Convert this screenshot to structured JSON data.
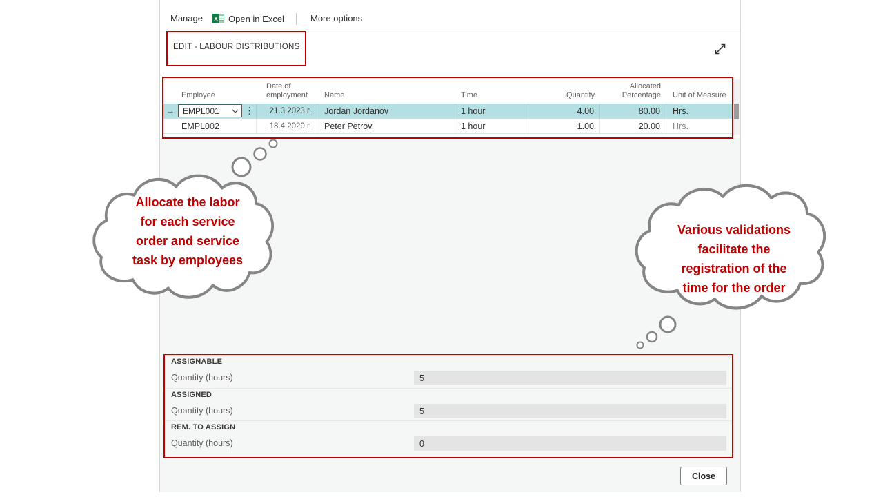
{
  "toolbar": {
    "manage": "Manage",
    "open_in_excel": "Open in Excel",
    "more_options": "More options"
  },
  "dialog": {
    "title": "EDIT - LABOUR DISTRIBUTIONS",
    "close": "Close"
  },
  "table": {
    "columns": [
      "Employee",
      "Date of\nemployment",
      "Name",
      "Time",
      "Quantity",
      "Allocated\nPercentage",
      "Unit of Measure"
    ],
    "rows": [
      {
        "employee": "EMPL001",
        "date": "21.3.2023 г.",
        "name": "Jordan Jordanov",
        "time": "1 hour",
        "quantity": "4.00",
        "allocated_percentage": "80.00",
        "unit_of_measure": "Hrs.",
        "selected": true
      },
      {
        "employee": "EMPL002",
        "date": "18.4.2020 г.",
        "name": "Peter Petrov",
        "time": "1 hour",
        "quantity": "1.00",
        "allocated_percentage": "20.00",
        "unit_of_measure": "Hrs.",
        "selected": false
      }
    ]
  },
  "totals": {
    "groups": [
      {
        "heading": "ASSIGNABLE",
        "label": "Quantity (hours)",
        "value": "5"
      },
      {
        "heading": "ASSIGNED",
        "label": "Quantity (hours)",
        "value": "5"
      },
      {
        "heading": "REM. TO ASSIGN",
        "label": "Quantity (hours)",
        "value": "0"
      }
    ]
  },
  "annotations": {
    "left_bubble": "Allocate the labor\nfor each service\norder and service\ntask by employees",
    "right_bubble": "Various validations\nfacilitate the\nregistration of the\ntime for the order"
  },
  "colors": {
    "selected_row": "#b4dfe3",
    "annotation_red": "#c00000",
    "excel_green": "#107c41"
  }
}
